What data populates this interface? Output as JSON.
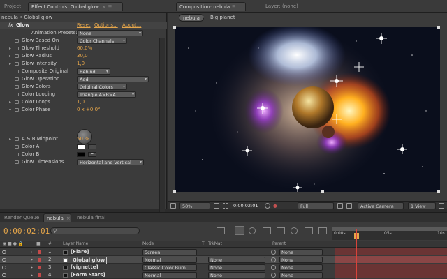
{
  "top_tabs": {
    "project": "Project",
    "effect_controls": "Effect Controls: Global glow",
    "composition": "Composition: nebula",
    "layer": "Layer: (none)"
  },
  "effect_panel": {
    "breadcrumb": "nebula • Global glow",
    "effect_name": "Glow",
    "reset": "Reset",
    "options": "Options...",
    "about": "About...",
    "rows": [
      {
        "label": "Animation Presets:",
        "value": "None",
        "kind": "dropdown"
      },
      {
        "label": "Glow Based On",
        "value": "Color Channels",
        "kind": "dropdown"
      },
      {
        "label": "Glow Threshold",
        "value": "60,0%",
        "kind": "value"
      },
      {
        "label": "Glow Radius",
        "value": "30,0",
        "kind": "value"
      },
      {
        "label": "Glow Intensity",
        "value": "1,0",
        "kind": "value"
      },
      {
        "label": "Composite Original",
        "value": "Behind",
        "kind": "dropdown"
      },
      {
        "label": "Glow Operation",
        "value": "Add",
        "kind": "dropdown"
      },
      {
        "label": "Glow Colors",
        "value": "Original Colors",
        "kind": "dropdown"
      },
      {
        "label": "Color Looping",
        "value": "Triangle A>B>A",
        "kind": "dropdown"
      },
      {
        "label": "Color Loops",
        "value": "1,0",
        "kind": "value"
      },
      {
        "label": "Color Phase",
        "value": "0 x +0,0°",
        "kind": "value"
      },
      {
        "label": "A & B Midpoint",
        "value": "50 %",
        "kind": "value"
      },
      {
        "label": "Color A",
        "value": "",
        "kind": "color"
      },
      {
        "label": "Color B",
        "value": "",
        "kind": "color"
      },
      {
        "label": "Glow Dimensions",
        "value": "Horizontal and Vertical",
        "kind": "dropdown"
      }
    ]
  },
  "comp_panel": {
    "crumb_active": "nebula",
    "crumb_next": "Big planet",
    "zoom": "50%",
    "timecode": "0:00:02:01",
    "resolution": "Full",
    "camera": "Active Camera",
    "view": "1 View"
  },
  "timeline": {
    "tabs": [
      "Render Queue",
      "nebula",
      "nebula final"
    ],
    "timecode": "0:00:02:01",
    "columns": {
      "num": "#",
      "layer_name": "Layer Name",
      "mode": "Mode",
      "t": "T",
      "trkmat": "TrkMat",
      "parent": "Parent"
    },
    "ruler": [
      "0:00s",
      "05s",
      "10s"
    ],
    "layers": [
      {
        "num": "1",
        "name": "[Flare]",
        "mode": "Screen",
        "trkmat": "",
        "parent": "None"
      },
      {
        "num": "2",
        "name": "Global glow",
        "mode": "Normal",
        "trkmat": "None",
        "parent": "None"
      },
      {
        "num": "3",
        "name": "[vignette]",
        "mode": "Classic Color Burn",
        "trkmat": "None",
        "parent": "None"
      },
      {
        "num": "4",
        "name": "[Form Stars]",
        "mode": "Normal",
        "trkmat": "None",
        "parent": "None"
      }
    ]
  }
}
